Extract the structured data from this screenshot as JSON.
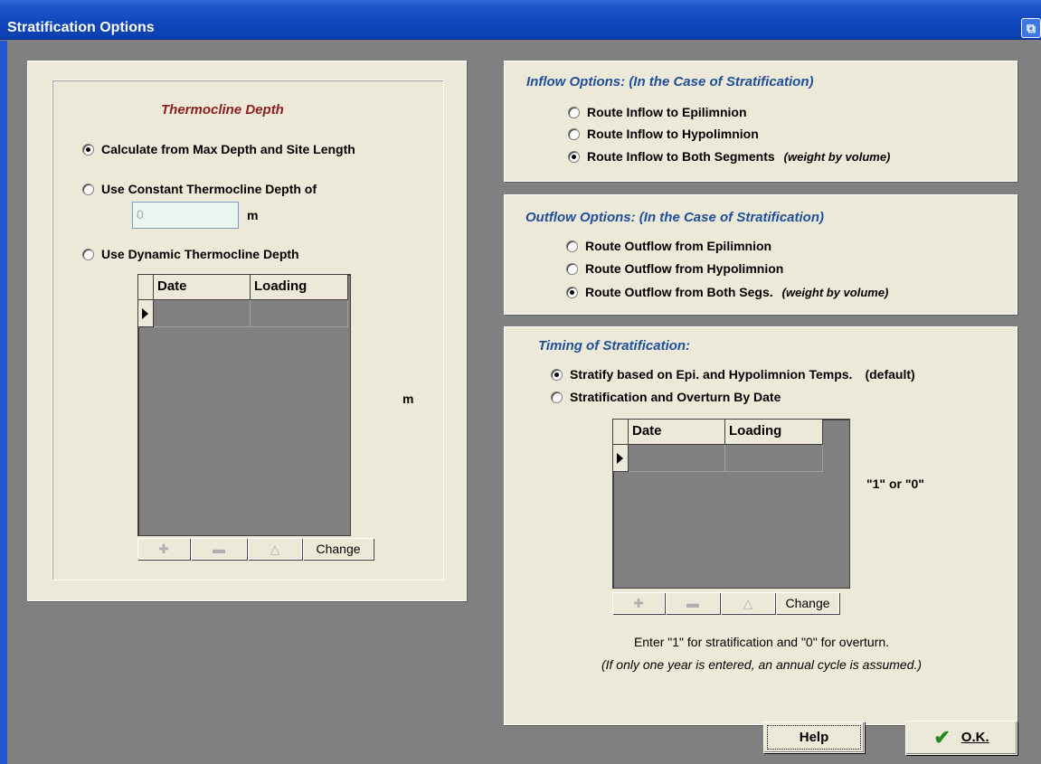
{
  "window": {
    "title": "Stratification Options"
  },
  "thermocline": {
    "title": "Thermocline Depth",
    "options": [
      {
        "label": "Calculate from Max Depth and Site Length",
        "checked": true
      },
      {
        "label": "Use Constant Thermocline Depth of",
        "checked": false
      },
      {
        "label": "Use Dynamic Thermocline Depth",
        "checked": false
      }
    ],
    "constant_value": "0",
    "constant_unit": "m",
    "grid_headers": [
      "Date",
      "Loading"
    ],
    "grid_unit": "m",
    "nav_change": "Change"
  },
  "inflow": {
    "title": "Inflow Options: (In the Case of Stratification)",
    "options": [
      {
        "label": "Route Inflow to Epilimnion",
        "checked": false,
        "note": ""
      },
      {
        "label": "Route Inflow to Hypolimnion",
        "checked": false,
        "note": ""
      },
      {
        "label": "Route Inflow to Both Segments",
        "checked": true,
        "note": "(weight by volume)"
      }
    ]
  },
  "outflow": {
    "title": "Outflow Options: (In the Case of Stratification)",
    "options": [
      {
        "label": "Route Outflow from Epilimnion",
        "checked": false,
        "note": ""
      },
      {
        "label": "Route Outflow from Hypolimnion",
        "checked": false,
        "note": ""
      },
      {
        "label": "Route Outflow from Both Segs.",
        "checked": true,
        "note": "(weight by volume)"
      }
    ]
  },
  "timing": {
    "title": "Timing of Stratification:",
    "options": [
      {
        "label": "Stratify based on Epi. and Hypolimnion Temps.",
        "checked": true,
        "note": "(default)"
      },
      {
        "label": "Stratification and Overturn By Date",
        "checked": false,
        "note": ""
      }
    ],
    "grid_headers": [
      "Date",
      "Loading"
    ],
    "grid_hint": "\"1\" or \"0\"",
    "nav_change": "Change",
    "footer_line1": "Enter \"1\" for stratification and \"0\" for overturn.",
    "footer_line2": "(If only one year is entered, an annual cycle is assumed.)"
  },
  "buttons": {
    "help": "Help",
    "ok": "O.K.",
    "ok_underline": "O"
  }
}
